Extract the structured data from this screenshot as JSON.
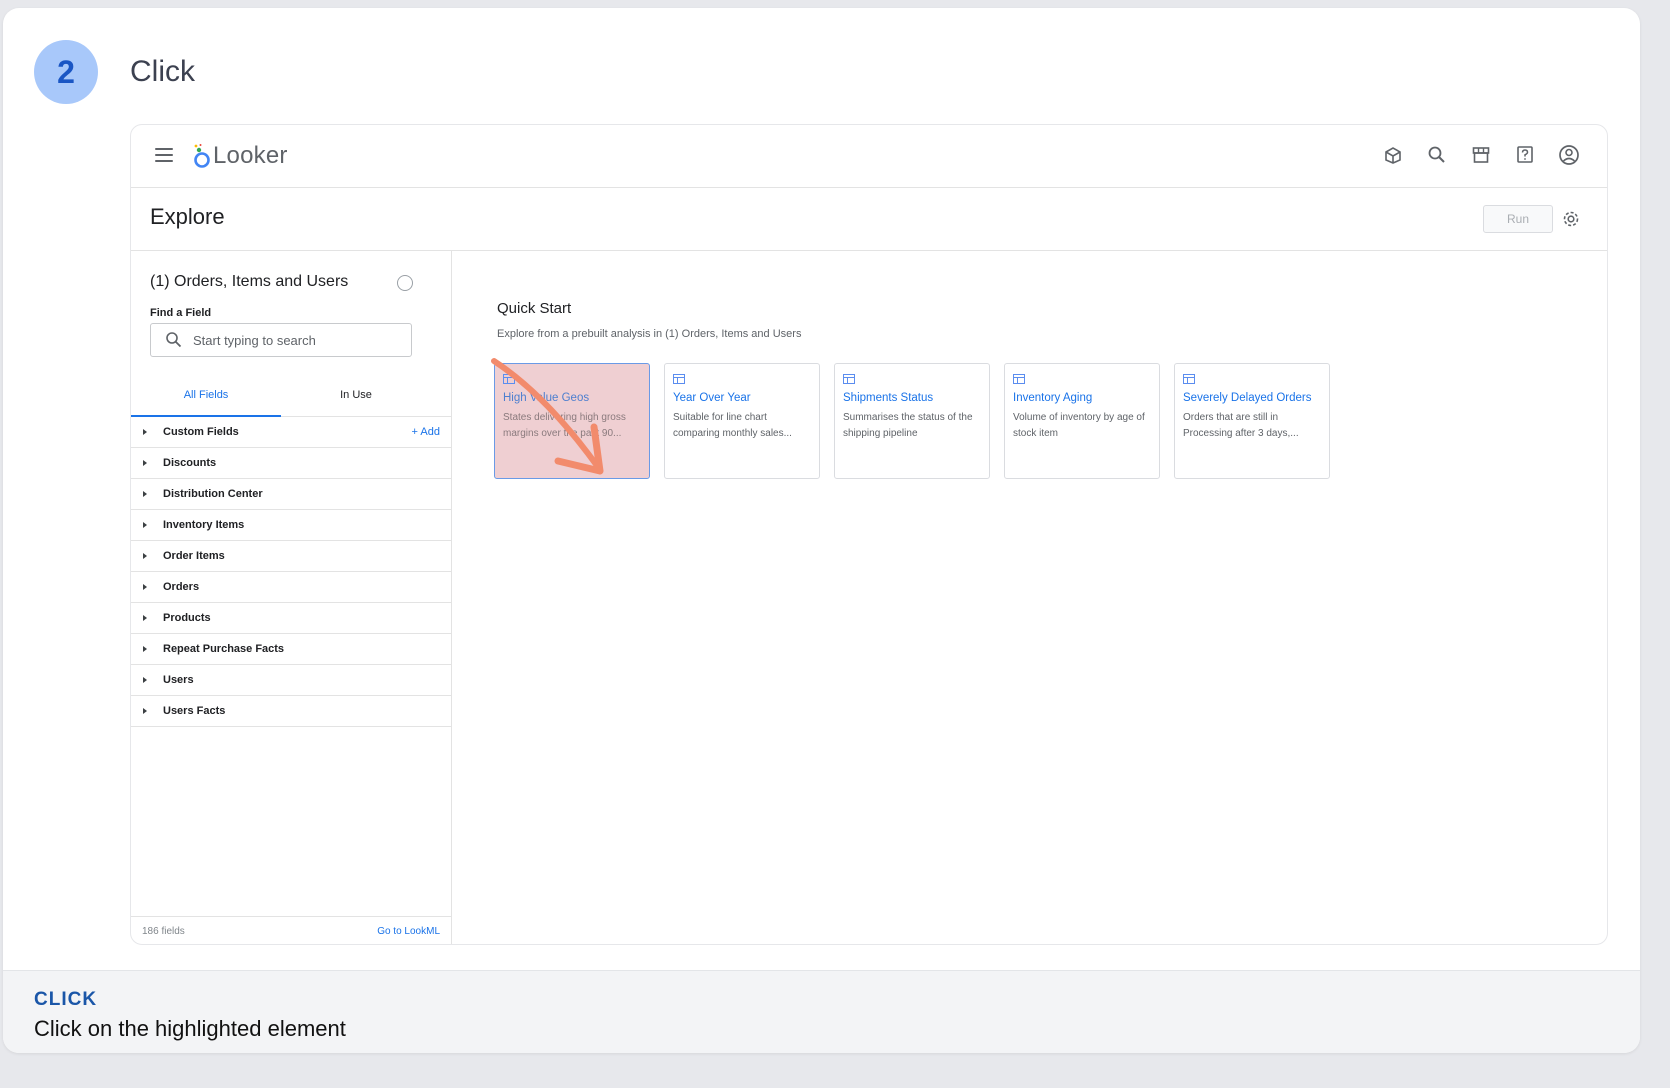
{
  "step": {
    "number": "2",
    "title": "Click"
  },
  "app": {
    "logo_text": "Looker",
    "page_title": "Explore",
    "run_label": "Run"
  },
  "sidebar": {
    "model_title": "(1) Orders, Items and Users",
    "find_label": "Find a Field",
    "search_placeholder": "Start typing to search",
    "tabs": [
      {
        "label": "All Fields",
        "active": true
      },
      {
        "label": "In Use",
        "active": false
      }
    ],
    "add_label": "Add",
    "fields": [
      "Custom Fields",
      "Discounts",
      "Distribution Center",
      "Inventory Items",
      "Order Items",
      "Orders",
      "Products",
      "Repeat Purchase Facts",
      "Users",
      "Users Facts"
    ],
    "footer_count": "186 fields",
    "footer_link": "Go to LookML"
  },
  "quick_start": {
    "title": "Quick Start",
    "subtitle": "Explore from a prebuilt analysis in (1) Orders, Items and Users",
    "cards": [
      {
        "title": "High Value Geos",
        "desc": "States delivering high gross margins over the past 90...",
        "highlighted": true
      },
      {
        "title": "Year Over Year",
        "desc": "Suitable for line chart comparing monthly sales...",
        "highlighted": false
      },
      {
        "title": "Shipments Status",
        "desc": "Summarises the status of the shipping pipeline",
        "highlighted": false
      },
      {
        "title": "Inventory Aging",
        "desc": "Volume of inventory by age of stock item",
        "highlighted": false
      },
      {
        "title": "Severely Delayed Orders",
        "desc": "Orders that are still in Processing after 3 days,...",
        "highlighted": false
      }
    ]
  },
  "footer": {
    "action_type": "CLICK",
    "action_desc": "Click on the highlighted element"
  },
  "colors": {
    "badge_bg": "#a8c8fa",
    "badge_text": "#1a56c4",
    "accent": "#1a73e8",
    "highlight_bg": "#efcfd2",
    "arrow": "#f28b6c"
  }
}
